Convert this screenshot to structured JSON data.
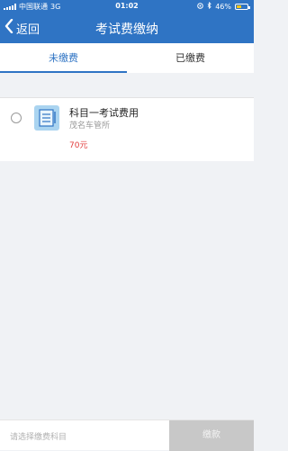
{
  "status_bar": {
    "carrier": "中国联通",
    "network": "3G",
    "time": "01:02",
    "battery_text": "46%",
    "battery_level": 0.46
  },
  "nav": {
    "back_label": "返回",
    "title": "考试费缴纳"
  },
  "tabs": [
    {
      "label": "未缴费",
      "active": true
    },
    {
      "label": "已缴费",
      "active": false
    }
  ],
  "fee_items": [
    {
      "title": "科目一考试费用",
      "subtitle": "茂名车管所",
      "price": "70元",
      "icon": "document-list-icon"
    }
  ],
  "bottom_bar": {
    "placeholder": "请选择缴费科目",
    "pay_label": "缴款"
  },
  "colors": {
    "primary": "#2f74c4",
    "price": "#e23c3c",
    "disabled_button": "#c8c8c8"
  }
}
